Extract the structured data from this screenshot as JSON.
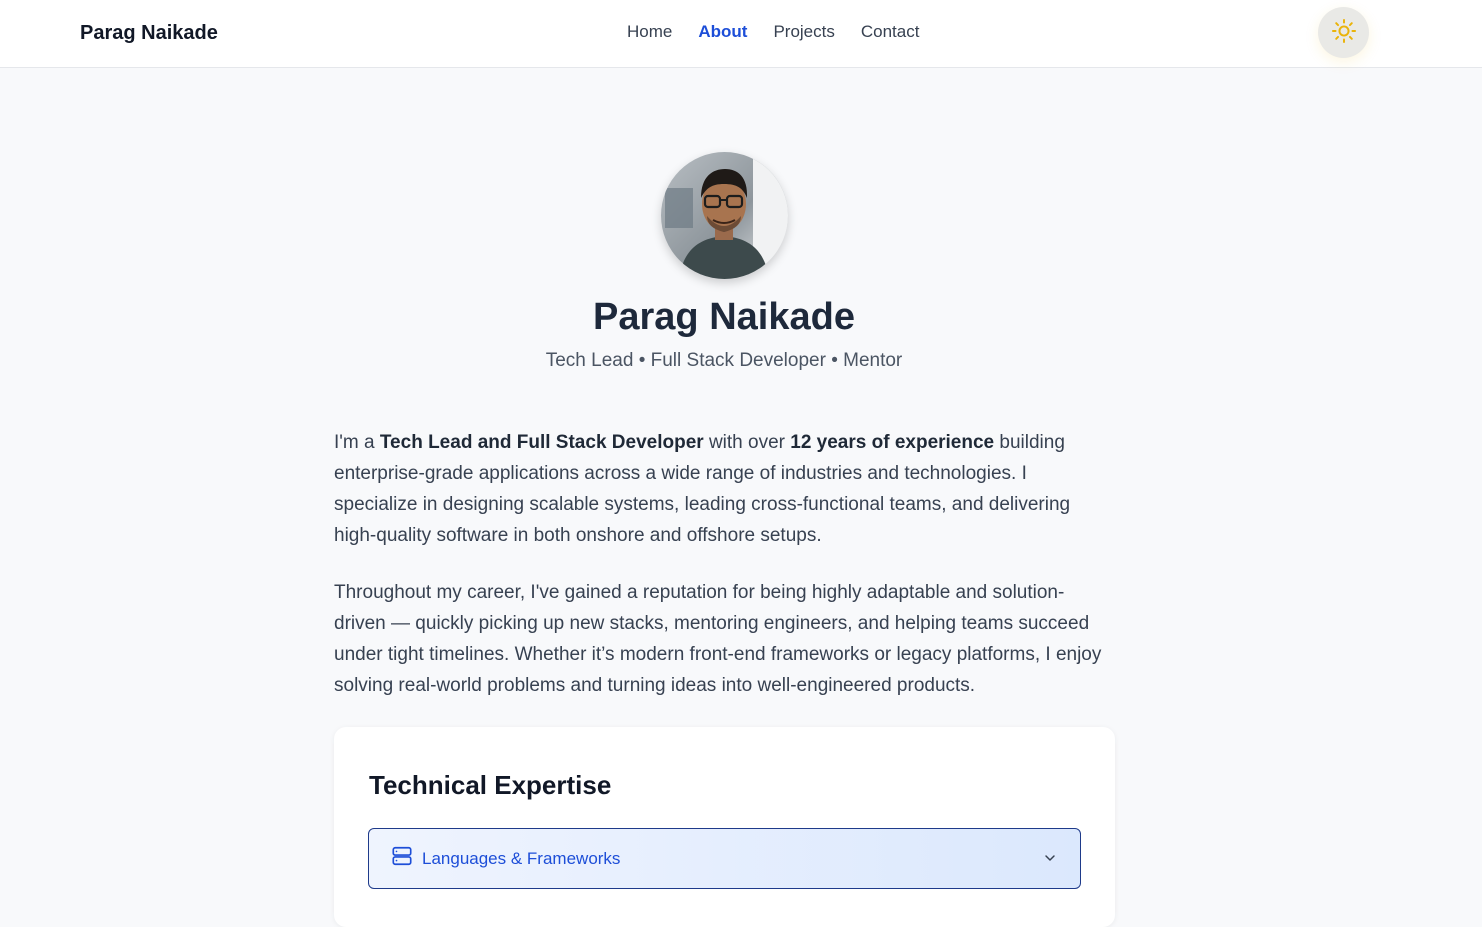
{
  "header": {
    "brand": "Parag Naikade",
    "nav": [
      {
        "label": "Home",
        "active": false
      },
      {
        "label": "About",
        "active": true
      },
      {
        "label": "Projects",
        "active": false
      },
      {
        "label": "Contact",
        "active": false
      }
    ],
    "theme_toggle_icon": "sun-icon"
  },
  "profile": {
    "name": "Parag Naikade",
    "tagline": "Tech Lead • Full Stack Developer • Mentor"
  },
  "bio": {
    "p1_intro": "I'm a ",
    "p1_role": "Tech Lead and Full Stack Developer",
    "p1_mid": " with over ",
    "p1_years": "12 years of experience",
    "p1_rest": " building enterprise-grade applications across a wide range of industries and technologies. I specialize in designing scalable systems, leading cross-functional teams, and delivering high-quality software in both onshore and offshore setups.",
    "p2": "Throughout my career, I've gained a reputation for being highly adaptable and solution-driven — quickly picking up new stacks, mentoring engineers, and helping teams succeed under tight timelines. Whether it’s modern front-end frameworks or legacy platforms, I enjoy solving real-world problems and turning ideas into well-engineered products."
  },
  "expertise": {
    "title": "Technical Expertise",
    "sections": [
      {
        "label": "Languages & Frameworks",
        "icon": "server-icon",
        "expanded": false
      }
    ]
  },
  "colors": {
    "accent": "#1d4ed8",
    "sun": "#eab308",
    "background": "#f8f9fb"
  }
}
